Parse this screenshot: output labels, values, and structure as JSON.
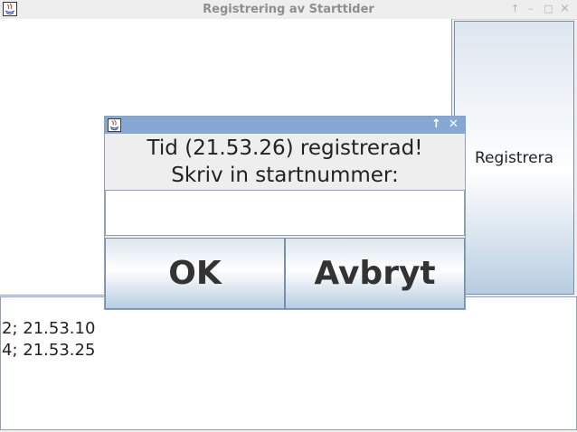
{
  "window": {
    "title": "Registrering av Starttider",
    "minimize_icon": "↑",
    "restore_icon": "–",
    "maximize_icon": "□",
    "close_icon": "×"
  },
  "main": {
    "register_button_label": "Registrera",
    "log_lines": [
      "2; 21.53.10",
      "4; 21.53.25"
    ]
  },
  "dialog": {
    "message_line1": "Tid (21.53.26) registrerad!",
    "message_line2": "Skriv in startnummer:",
    "input_value": "",
    "ok_label": "OK",
    "cancel_label": "Avbryt",
    "maximize_icon": "↑",
    "close_icon": "✕"
  },
  "colors": {
    "dialog_titlebar": "#86a8d2",
    "button_gradient_bottom": "#b8cde1"
  }
}
